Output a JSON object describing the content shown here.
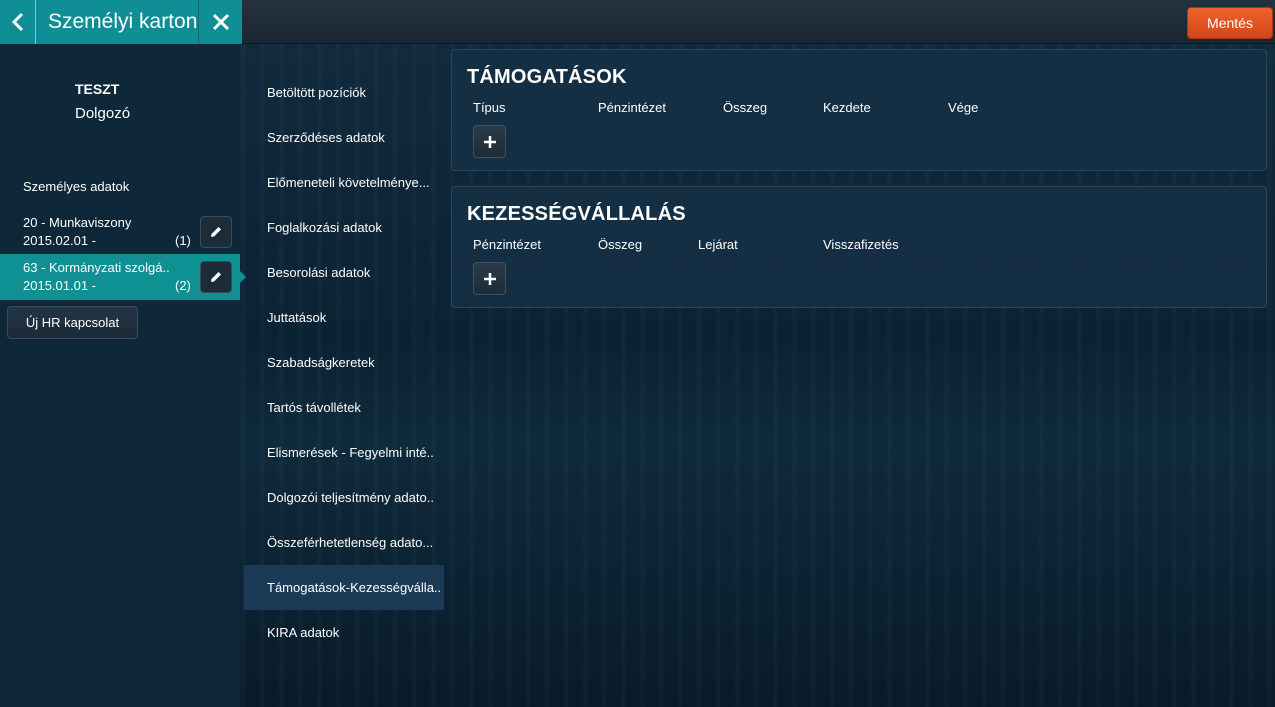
{
  "header": {
    "title": "Személyi karton",
    "back_icon": "chevron-left-icon",
    "close_icon": "close-icon",
    "save_label": "Mentés",
    "save_color": "#e0511f",
    "accent_color": "#0f8f95"
  },
  "person": {
    "name": "TESZT",
    "role": "Dolgozó"
  },
  "sidebar": {
    "section_label": "Személyes adatok",
    "relations": [
      {
        "title": "20 - Munkaviszony",
        "date": "2015.02.01 -",
        "count": "(1)",
        "active": false
      },
      {
        "title": "63 - Kormányzati szolgá..",
        "date": "2015.01.01 -",
        "count": "(2)",
        "active": true
      }
    ],
    "new_button": "Új HR kapcsolat"
  },
  "nav": {
    "items": [
      "Betöltött pozíciók",
      "Szerződéses adatok",
      "Előmeneteli követelménye...",
      "Foglalkozási adatok",
      "Besorolási adatok",
      "Juttatások",
      "Szabadságkeretek",
      "Tartós távollétek",
      "Elismerések - Fegyelmi inté..",
      "Dolgozói teljesítmény adato..",
      "Összeférhetetlenség adato...",
      "Támogatások-Kezességválla..",
      "KIRA adatok"
    ],
    "active_index": 11
  },
  "panels": {
    "support": {
      "title": "TÁMOGATÁSOK",
      "columns": [
        "Típus",
        "Pénzintézet",
        "Összeg",
        "Kezdete",
        "Vége"
      ],
      "add_icon": "plus-icon"
    },
    "guarantee": {
      "title": "KEZESSÉGVÁLLALÁS",
      "columns": [
        "Pénzintézet",
        "Összeg",
        "Lejárat",
        "Visszafizetés"
      ],
      "add_icon": "plus-icon"
    }
  }
}
